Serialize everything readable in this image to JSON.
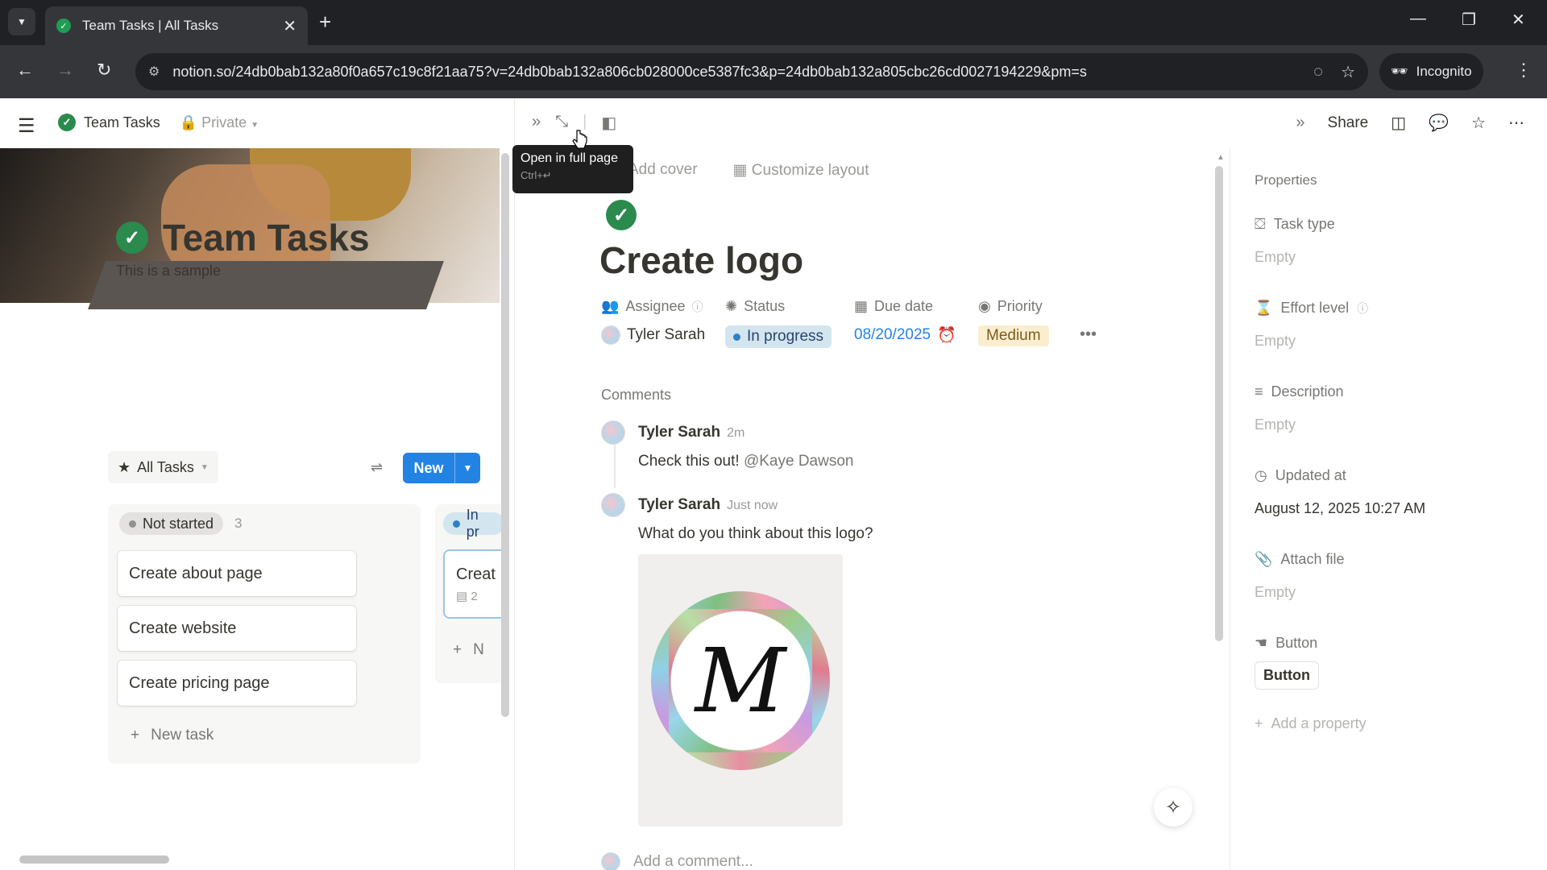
{
  "browser": {
    "tab_title": "Team Tasks | All Tasks",
    "url": "notion.so/24db0bab132a80f0a657c19c8f21aa75?v=24db0bab132a806cb028000ce5387fc3&p=24db0bab132a805cbc26cd0027194229&pm=s",
    "incognito_label": "Incognito"
  },
  "app": {
    "breadcrumb_title": "Team Tasks",
    "privacy": "Private",
    "share_label": "Share"
  },
  "left": {
    "page_title": "Team Tasks",
    "subtitle": "This is a sample",
    "view_name": "All Tasks",
    "new_label": "New",
    "columns": [
      {
        "label": "Not started",
        "count": "3",
        "cards": [
          "Create about page",
          "Create website",
          "Create pricing page"
        ],
        "new_task_label": "New task"
      },
      {
        "label": "In pr",
        "card_title": "Creat",
        "comment_count": "2",
        "new_label": "N"
      }
    ]
  },
  "peek": {
    "tooltip_title": "Open in full page",
    "tooltip_shortcut": "Ctrl+↵",
    "add_cover": "Add cover",
    "customize_layout": "Customize layout",
    "title": "Create logo",
    "properties": {
      "assignee_label": "Assignee",
      "assignee_value": "Tyler Sarah",
      "status_label": "Status",
      "status_value": "In progress",
      "due_label": "Due date",
      "due_value": "08/20/2025",
      "priority_label": "Priority",
      "priority_value": "Medium"
    },
    "comments_heading": "Comments",
    "comments": [
      {
        "author": "Tyler Sarah",
        "time": "2m",
        "text": "Check this out! ",
        "mention": "@Kaye Dawson"
      },
      {
        "author": "Tyler Sarah",
        "time": "Just now",
        "text": "What do you think about this logo?"
      }
    ],
    "logo_letter": "M",
    "add_comment_placeholder": "Add a comment..."
  },
  "sidebar": {
    "heading": "Properties",
    "items": [
      {
        "label": "Task type",
        "value": "Empty"
      },
      {
        "label": "Effort level",
        "value": "Empty"
      },
      {
        "label": "Description",
        "value": "Empty"
      },
      {
        "label": "Updated at",
        "value": "August 12, 2025 10:27 AM"
      },
      {
        "label": "Attach file",
        "value": "Empty"
      },
      {
        "label": "Button",
        "value": "Button"
      }
    ],
    "add_property": "Add a property"
  },
  "colors": {
    "accent": "#2383e2",
    "status_bg": "#d3e5ef",
    "priority_bg": "#fbeecf",
    "done_green": "#2b8a4e"
  },
  "icons": [
    "chevron-down-icon",
    "close-icon",
    "plus-icon",
    "back-icon",
    "forward-icon",
    "reload-icon",
    "site-info-icon",
    "eye-off-icon",
    "star-icon",
    "incognito-icon",
    "more-vert-icon",
    "hamburger-icon",
    "check-circle-icon",
    "lock-icon",
    "double-chevron-icon",
    "expand-icon",
    "side-peek-icon",
    "comment-icon",
    "more-horiz-icon",
    "filter-icon",
    "people-icon",
    "status-icon",
    "calendar-icon",
    "priority-icon",
    "alarm-icon",
    "hourglass-icon",
    "lines-icon",
    "clock-icon",
    "paperclip-icon",
    "button-icon",
    "ai-icon"
  ]
}
